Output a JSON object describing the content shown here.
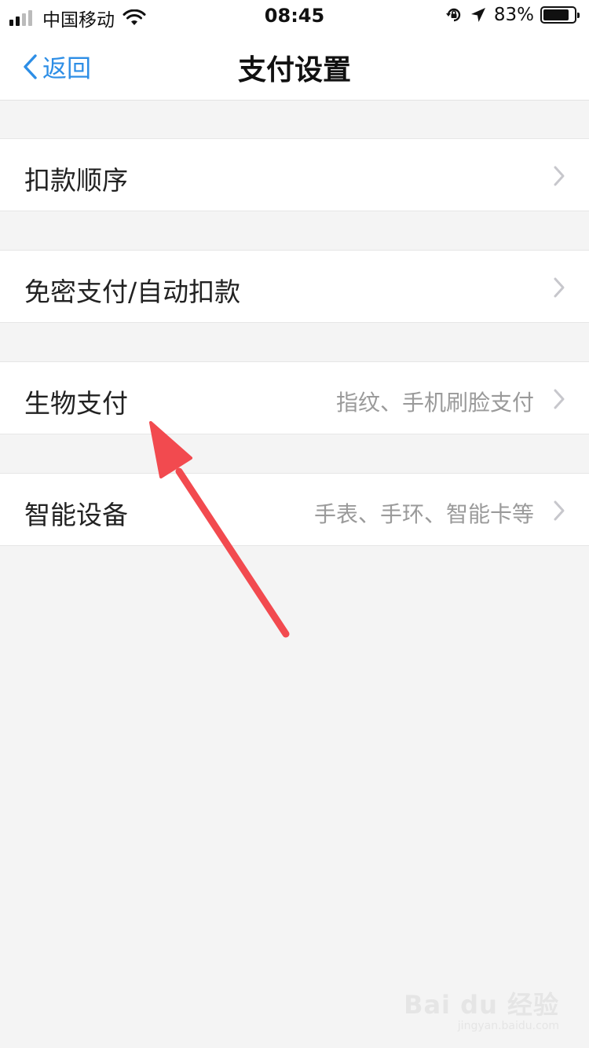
{
  "status_bar": {
    "carrier": "中国移动",
    "time": "08:45",
    "battery_percent": "83%",
    "battery_level": 0.83,
    "signal_bars_active": 2,
    "signal_bars_total": 4
  },
  "nav": {
    "back_label": "返回",
    "title": "支付设置"
  },
  "settings": {
    "items": [
      {
        "label": "扣款顺序",
        "detail": ""
      },
      {
        "label": "免密支付/自动扣款",
        "detail": ""
      },
      {
        "label": "生物支付",
        "detail": "指纹、手机刷脸支付"
      },
      {
        "label": "智能设备",
        "detail": "手表、手环、智能卡等"
      }
    ]
  },
  "watermark": {
    "logo_text": "Bai du 经验",
    "url": "jingyan.baidu.com"
  },
  "colors": {
    "accent": "#2d8ee6",
    "annotation_arrow": "#f24a4f",
    "background": "#f4f4f4"
  },
  "icons": {
    "back": "chevron-left-icon",
    "row": "chevron-right-icon",
    "wifi": "wifi-icon",
    "orientation_lock": "rotation-lock-icon",
    "location": "location-arrow-icon",
    "battery": "battery-icon"
  }
}
